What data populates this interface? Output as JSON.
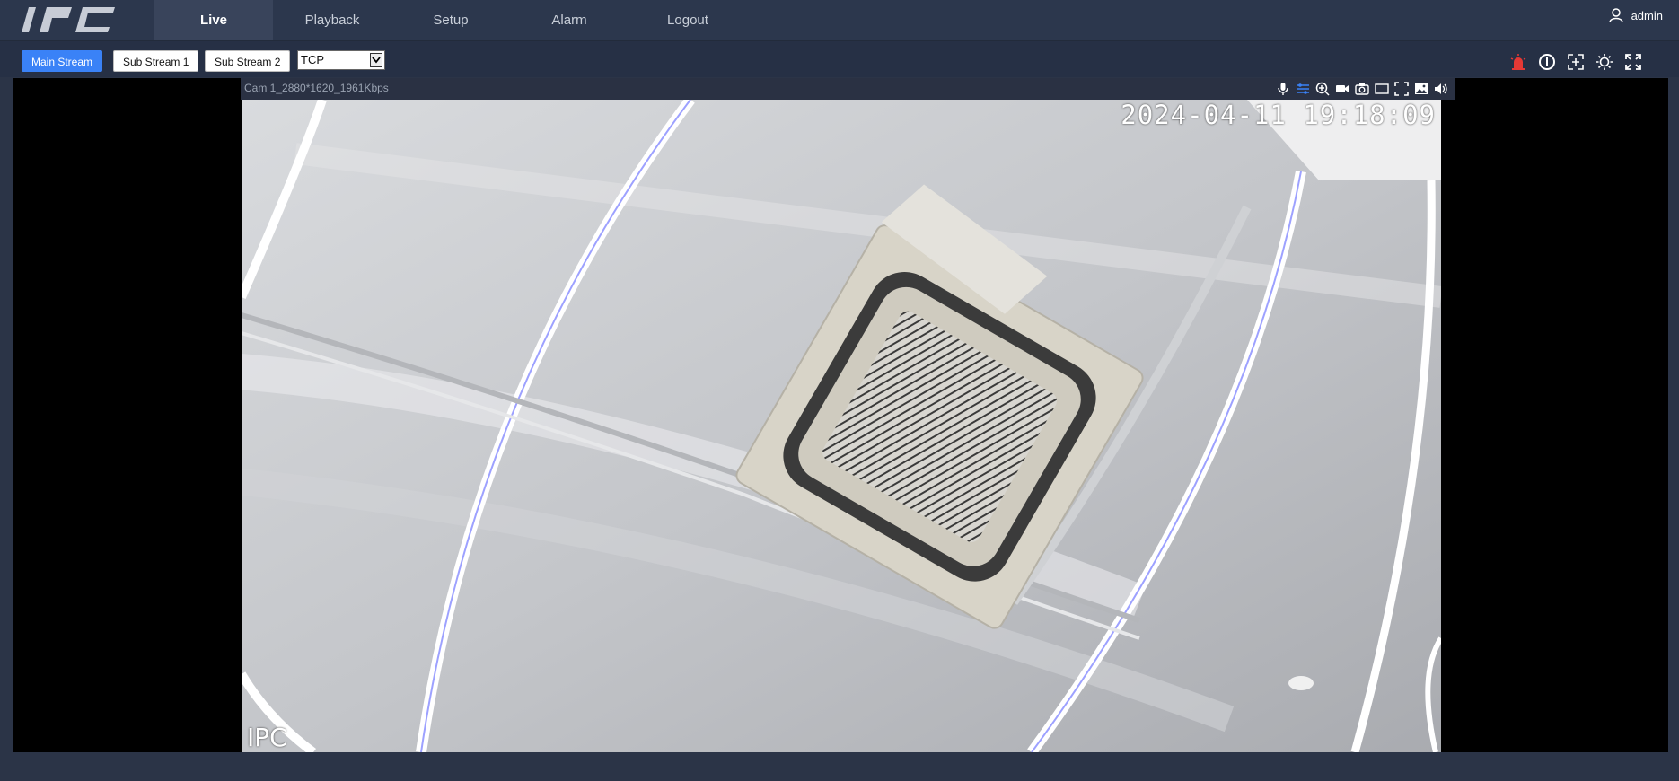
{
  "app": {
    "logo_text": "IPC",
    "user": "admin"
  },
  "nav": {
    "items": [
      "Live",
      "Playback",
      "Setup",
      "Alarm",
      "Logout"
    ]
  },
  "toolbar": {
    "streams": [
      "Main Stream",
      "Sub Stream 1",
      "Sub Stream 2"
    ],
    "protocol": "TCP",
    "right_icons": [
      "alarm-siren-icon",
      "info-icon",
      "add-window-icon",
      "brightness-icon",
      "fullscreen-icon"
    ]
  },
  "video": {
    "title": "Cam 1_2880*1620_1961Kbps",
    "icons": [
      "microphone-icon",
      "stream-adjust-icon",
      "zoom-in-icon",
      "record-icon",
      "snapshot-icon",
      "aspect-ratio-icon",
      "fullscreen-icon",
      "image-icon",
      "speaker-icon"
    ],
    "osd_time": "2024-04-11 19:18:09",
    "osd_name": "IPC"
  },
  "colors": {
    "accent": "#3a82f7",
    "alarm": "#e53935",
    "nav_bg": "#2c374d"
  }
}
